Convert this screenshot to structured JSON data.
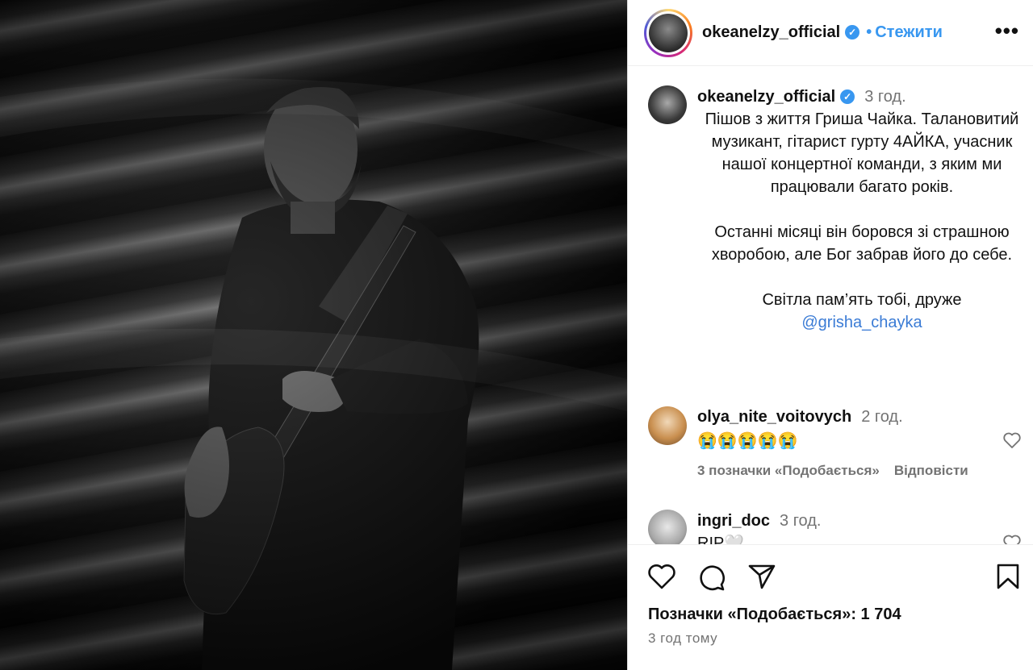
{
  "header": {
    "username": "okeanelzy_official",
    "follow_label": "Стежити",
    "more_label": "•••"
  },
  "caption": {
    "username": "okeanelzy_official",
    "time": "3 год.",
    "paragraphs": [
      "Пішов з життя Гриша Чайка. Талановитий музикант, гітарист гурту 4АЙКА, учасник нашої концертної команди, з яким ми працювали багато років.",
      "Останні місяці він боровся зі страшною хворобою, але Бог забрав його до себе.",
      "Світла пам’ять тобі, друже"
    ],
    "mention": "@grisha_chayka"
  },
  "comments": [
    {
      "username": "olya_nite_voitovych",
      "time": "2 год.",
      "text": "😭😭😭😭😭",
      "likes_label": "3 позначки «Подобається»",
      "reply_label": "Відповісти"
    },
    {
      "username": "ingri_doc",
      "time": "3 год.",
      "text": "RIP🤍"
    }
  ],
  "footer": {
    "likes": "Позначки «Подобається»: 1 704",
    "time_ago": "3 год тому"
  },
  "colors": {
    "accent": "#3897f0",
    "secondary_text": "#737373",
    "border": "#dbdbdb"
  },
  "icons": [
    "verified-badge-icon",
    "heart-icon",
    "comment-icon",
    "share-icon",
    "bookmark-icon",
    "more-icon"
  ]
}
